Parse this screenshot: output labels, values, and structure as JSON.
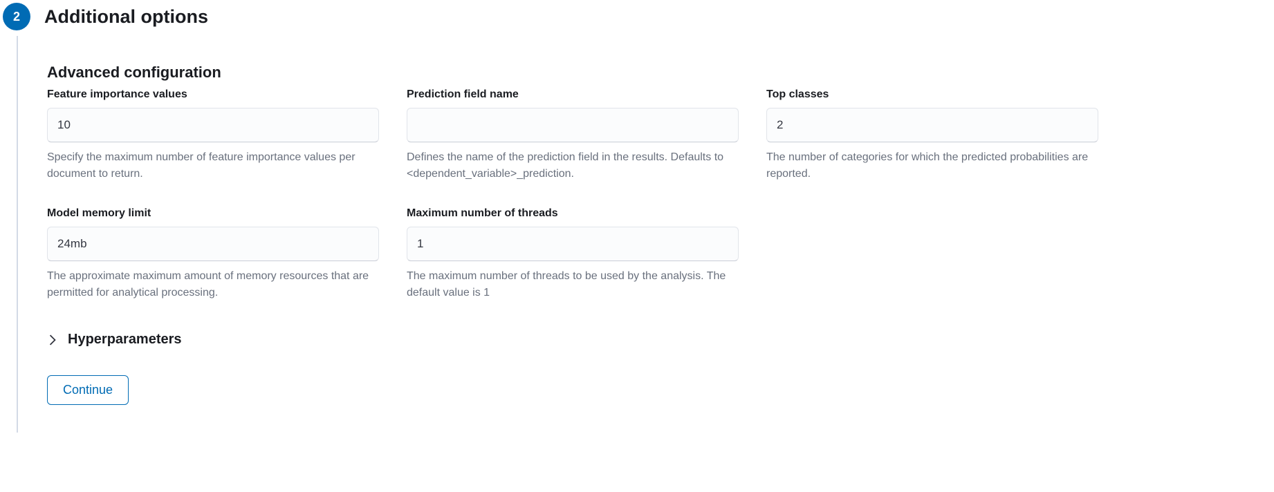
{
  "step": {
    "number": "2",
    "title": "Additional options"
  },
  "section": {
    "title": "Advanced configuration"
  },
  "fields": {
    "feature_importance": {
      "label": "Feature importance values",
      "value": "10",
      "help": "Specify the maximum number of feature importance values per document to return."
    },
    "prediction_field": {
      "label": "Prediction field name",
      "value": "",
      "help": "Defines the name of the prediction field in the results. Defaults to <dependent_variable>_prediction."
    },
    "top_classes": {
      "label": "Top classes",
      "value": "2",
      "help": "The number of categories for which the predicted probabilities are reported."
    },
    "model_memory": {
      "label": "Model memory limit",
      "value": "24mb",
      "help": "The approximate maximum amount of memory resources that are permitted for analytical processing."
    },
    "max_threads": {
      "label": "Maximum number of threads",
      "value": "1",
      "help": "The maximum number of threads to be used by the analysis. The default value is 1"
    }
  },
  "accordion": {
    "title": "Hyperparameters"
  },
  "buttons": {
    "continue": "Continue"
  }
}
